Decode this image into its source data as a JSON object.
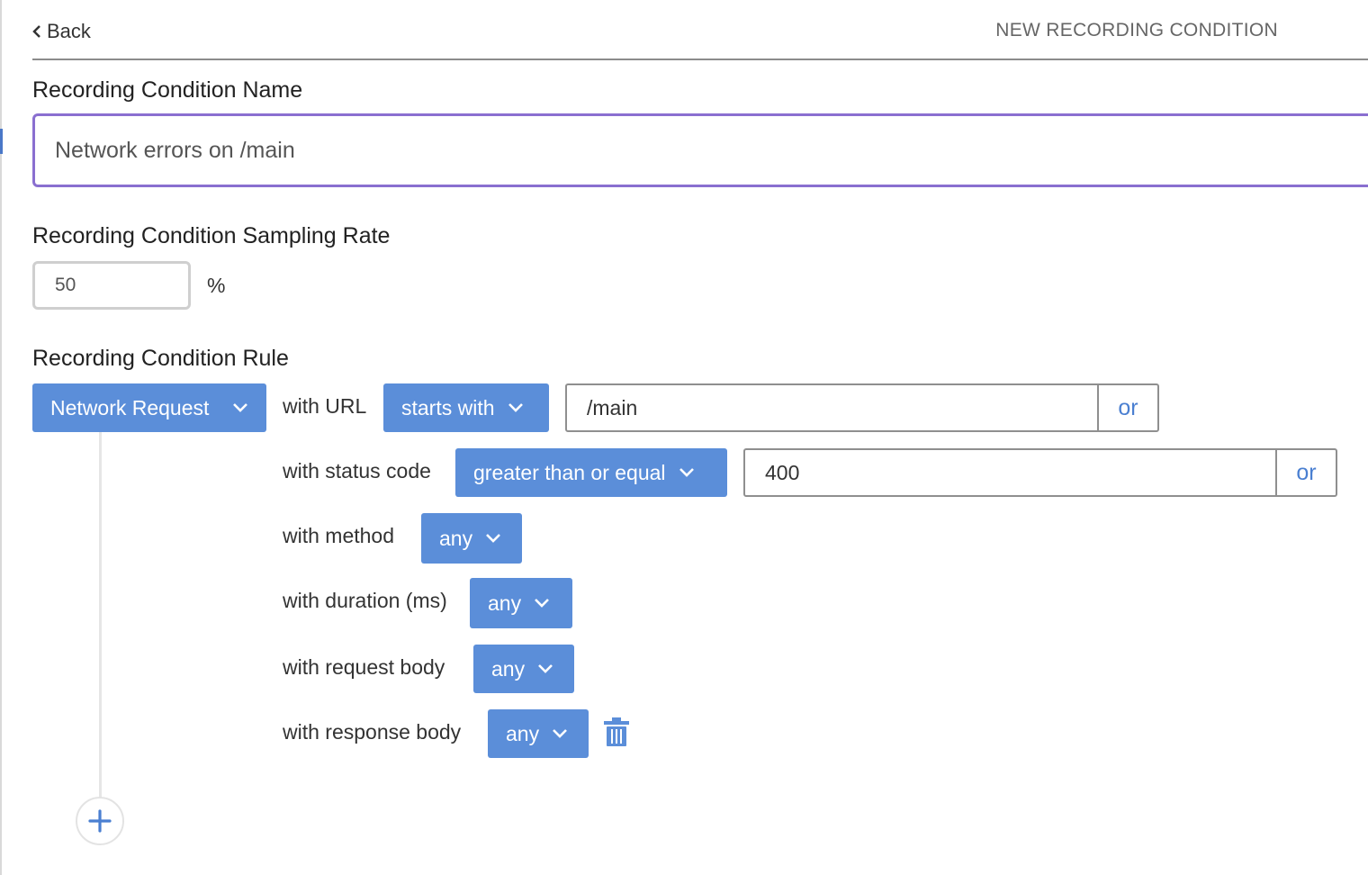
{
  "header": {
    "back_label": "Back",
    "title": "NEW RECORDING CONDITION"
  },
  "name_section": {
    "label": "Recording Condition Name",
    "value": "Network errors on /main"
  },
  "rate_section": {
    "label": "Recording Condition Sampling Rate",
    "value": "50",
    "unit": "%"
  },
  "rule_section": {
    "label": "Recording Condition Rule",
    "type_dropdown": "Network Request",
    "url": {
      "label": "with URL",
      "operator": "starts with",
      "value": "/main",
      "or_label": "or"
    },
    "status_code": {
      "label": "with status code",
      "operator": "greater than or equal",
      "value": "400",
      "or_label": "or"
    },
    "method": {
      "label": "with method",
      "value": "any"
    },
    "duration": {
      "label": "with duration (ms)",
      "value": "any"
    },
    "request_body": {
      "label": "with request body",
      "value": "any"
    },
    "response_body": {
      "label": "with response body",
      "value": "any"
    }
  },
  "colors": {
    "accent": "#5b8ed9",
    "focus_border": "#8a6fd0",
    "link": "#4a7fd1"
  },
  "icons": {
    "back": "chevron-left-icon",
    "dropdown": "chevron-down-icon",
    "delete": "trash-icon",
    "add": "plus-icon"
  }
}
